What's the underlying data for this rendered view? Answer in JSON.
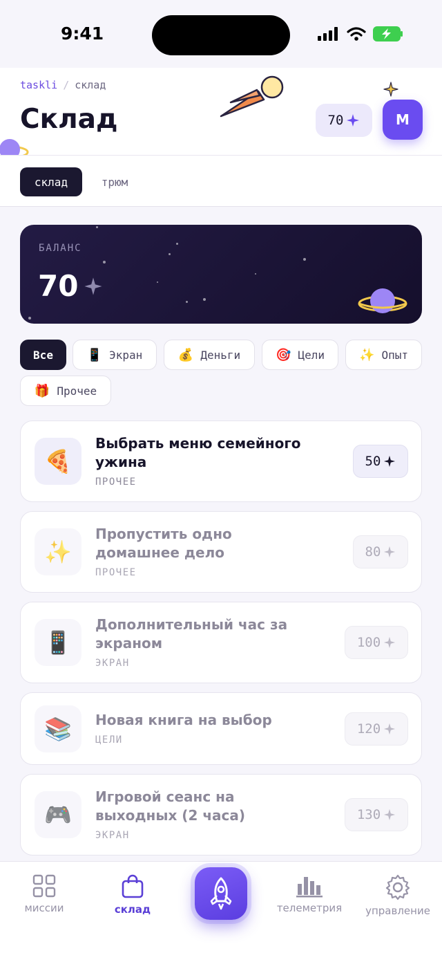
{
  "status_bar": {
    "time": "9:41"
  },
  "header": {
    "breadcrumb": {
      "app": "taskli",
      "separator": "/",
      "current": "склад"
    },
    "title": "Склад",
    "balance": "70",
    "avatar_initial": "M"
  },
  "tabs": [
    {
      "label": "склад",
      "active": true
    },
    {
      "label": "трюм",
      "active": false
    }
  ],
  "balance_card": {
    "label": "БАЛАНС",
    "value": "70"
  },
  "filters": [
    {
      "label": "Все",
      "icon": "",
      "active": true
    },
    {
      "label": "Экран",
      "icon": "📱",
      "active": false
    },
    {
      "label": "Деньги",
      "icon": "💰",
      "active": false
    },
    {
      "label": "Цели",
      "icon": "🎯",
      "active": false
    },
    {
      "label": "Опыт",
      "icon": "✨",
      "active": false
    },
    {
      "label": "Прочее",
      "icon": "🎁",
      "active": false
    }
  ],
  "rewards": [
    {
      "icon": "🍕",
      "title": "Выбрать меню семейного ужина",
      "category": "ПРОЧЕЕ",
      "price": "50",
      "affordable": true
    },
    {
      "icon": "✨",
      "title": "Пропустить одно домашнее дело",
      "category": "ПРОЧЕЕ",
      "price": "80",
      "affordable": false
    },
    {
      "icon": "📱",
      "title": "Дополнительный час за экраном",
      "category": "ЭКРАН",
      "price": "100",
      "affordable": false
    },
    {
      "icon": "📚",
      "title": "Новая книга на выбор",
      "category": "ЦЕЛИ",
      "price": "120",
      "affordable": false
    },
    {
      "icon": "🎮",
      "title": "Игровой сеанс на выходных (2 часа)",
      "category": "ЭКРАН",
      "price": "130",
      "affordable": false
    }
  ],
  "nav": {
    "missions": "миссии",
    "warehouse": "склад",
    "telemetry": "телеметрия",
    "control": "управление"
  },
  "colors": {
    "accent": "#6a4cf0",
    "dark": "#1b1830",
    "background": "#f6f5fb"
  }
}
